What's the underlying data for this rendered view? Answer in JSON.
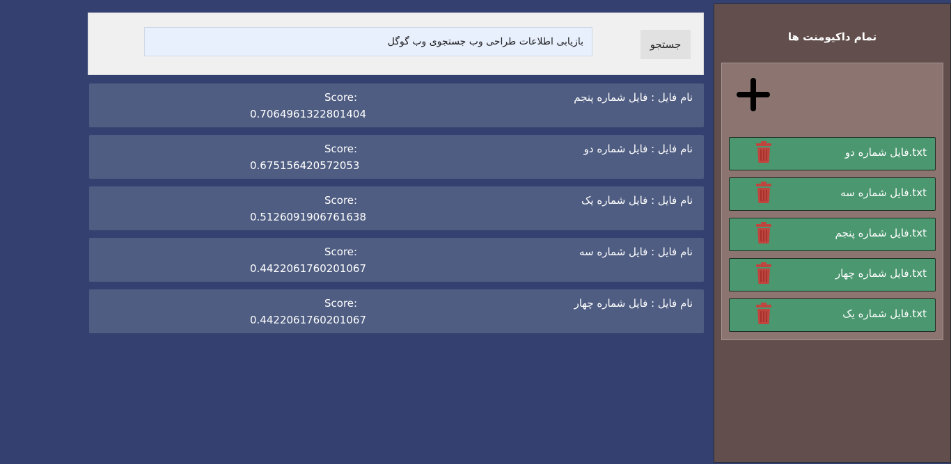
{
  "search": {
    "query": "بازیابی اطلاعات طراحی وب جستجوی وب گوگل",
    "button_label": "جستجو"
  },
  "results": [
    {
      "name": "نام فایل : فایل شماره پنجم",
      "score_label": "Score:",
      "score": "0.7064961322801404"
    },
    {
      "name": "نام فایل : فایل شماره دو",
      "score_label": "Score:",
      "score": "0.675156420572053"
    },
    {
      "name": "نام فایل : فایل شماره یک",
      "score_label": "Score:",
      "score": "0.5126091906761638"
    },
    {
      "name": "نام فایل : فایل شماره سه",
      "score_label": "Score:",
      "score": "0.4422061760201067"
    },
    {
      "name": "نام فایل : فایل شماره چهار",
      "score_label": "Score:",
      "score": "0.4422061760201067"
    }
  ],
  "sidebar": {
    "title": "تمام داکیومنت ها",
    "add_icon": "plus-icon",
    "delete_icon": "trash-icon",
    "documents": [
      {
        "label": "فایل شماره دو.txt"
      },
      {
        "label": "فایل شماره سه.txt"
      },
      {
        "label": "فایل شماره پنجم.txt"
      },
      {
        "label": "فایل شماره چهار.txt"
      },
      {
        "label": "فایل شماره یک.txt"
      }
    ]
  },
  "colors": {
    "page_background": "#344170",
    "result_card": "#4f5d82",
    "sidebar_background": "#624f4d",
    "document_panel": "#8c7571",
    "document_item": "#4b9770",
    "trash": "#c0453f",
    "search_panel": "#f0f0f0",
    "search_input": "#e8f0fe"
  }
}
